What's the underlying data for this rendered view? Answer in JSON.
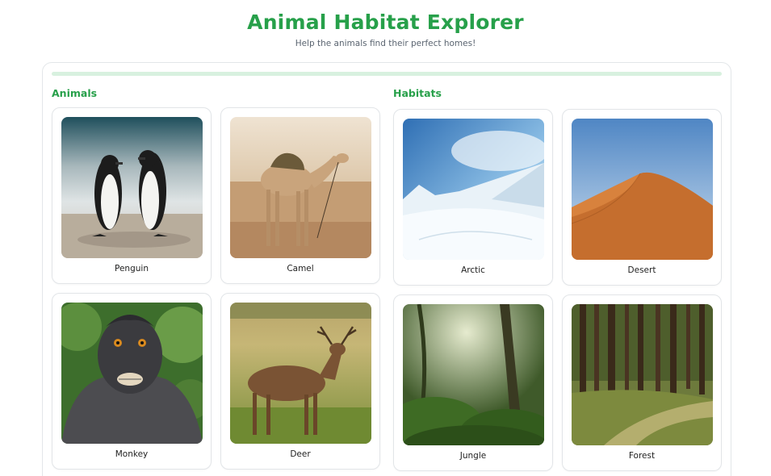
{
  "header": {
    "title": "Animal Habitat Explorer",
    "subtitle": "Help the animals find their perfect homes!"
  },
  "progress": {
    "fraction": 0.0
  },
  "animals": {
    "heading": "Animals",
    "items": [
      {
        "label": "Penguin",
        "image": "penguin-photo"
      },
      {
        "label": "Camel",
        "image": "camel-photo"
      },
      {
        "label": "Monkey",
        "image": "monkey-photo"
      },
      {
        "label": "Deer",
        "image": "deer-photo"
      }
    ]
  },
  "habitats": {
    "heading": "Habitats",
    "items": [
      {
        "label": "Arctic",
        "image": "arctic-photo"
      },
      {
        "label": "Desert",
        "image": "desert-photo"
      },
      {
        "label": "Jungle",
        "image": "jungle-photo"
      },
      {
        "label": "Forest",
        "image": "forest-photo"
      }
    ]
  },
  "colors": {
    "accent": "#27a04a",
    "track": "#d8f1df",
    "border": "#e2e5e8"
  }
}
